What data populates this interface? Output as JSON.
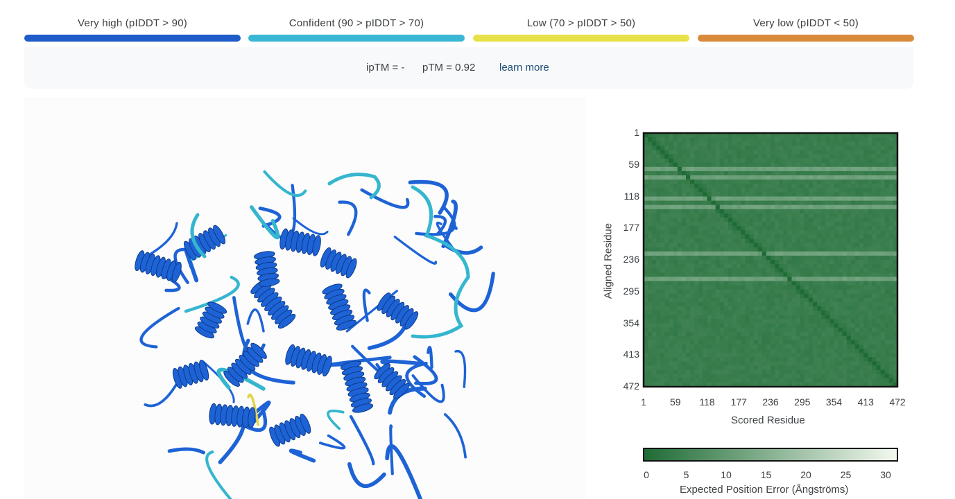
{
  "plddt_legend": [
    {
      "label": "Very high (pIDDT > 90)",
      "color": "#1f5cc9"
    },
    {
      "label": "Confident (90 > pIDDT > 70)",
      "color": "#3ab7d4"
    },
    {
      "label": "Low (70 > pIDDT > 50)",
      "color": "#e8e24a"
    },
    {
      "label": "Very low (pIDDT < 50)",
      "color": "#d98a3b"
    }
  ],
  "metrics": {
    "iptm": "ipTM = -",
    "ptm": "pTM = 0.92",
    "learn_more": "learn more"
  },
  "structure_viewer": {
    "main_color": "#1e63d6",
    "accent_color": "#35b6cf",
    "low_color": "#e3d54a"
  },
  "chart_data": {
    "type": "heatmap",
    "xlabel": "Scored Residue",
    "ylabel": "Aligned Residue",
    "x_ticks": [
      "1",
      "59",
      "118",
      "177",
      "236",
      "295",
      "354",
      "413",
      "472"
    ],
    "y_ticks": [
      "1",
      "59",
      "118",
      "177",
      "236",
      "295",
      "354",
      "413",
      "472"
    ],
    "n_residues": 472,
    "colorbar": {
      "label": "Expected Position Error (Ångströms)",
      "ticks": [
        "0",
        "5",
        "10",
        "15",
        "20",
        "25",
        "30"
      ],
      "range": [
        0,
        30
      ],
      "low_color": "#1e6b35",
      "high_color": "#f3f9ef"
    },
    "description_values": {
      "diagonal_error": 0,
      "typical_error": 3,
      "light_band_rows": [
        60,
        75,
        120,
        135,
        220,
        270
      ]
    }
  }
}
